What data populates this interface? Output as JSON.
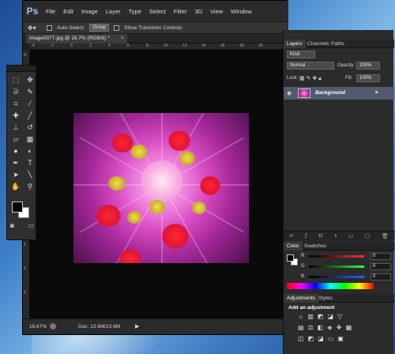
{
  "app": {
    "logo": "Ps"
  },
  "menu": [
    "File",
    "Edit",
    "Image",
    "Layer",
    "Type",
    "Select",
    "Filter",
    "3D",
    "View",
    "Window"
  ],
  "options_bar": {
    "auto_select_label": "Auto-Select:",
    "auto_select_value": "Group",
    "show_transform_label": "Show Transform Controls"
  },
  "document": {
    "tab_title": "Image0077.jpg @ 16.7% (RGB/8) *",
    "close": "×",
    "ruler_top": [
      "4",
      "2",
      "0",
      "2",
      "4",
      "6",
      "8",
      "10",
      "12",
      "14",
      "16",
      "18",
      "20"
    ],
    "ruler_left": [
      "0",
      "2",
      "4",
      "6",
      "8",
      "1",
      "1",
      "1",
      "1",
      "1",
      "2"
    ],
    "zoom": "16.67%",
    "doc_size": "Doc: 13.6M/13.6M"
  },
  "layers_panel": {
    "tabs": [
      "Layers",
      "Channels",
      "Paths"
    ],
    "kind": "Kind",
    "blend_mode": "Normal",
    "opacity_label": "Opacity:",
    "opacity_value": "100%",
    "lock_label": "Lock:",
    "fill_label": "Fill:",
    "fill_value": "100%",
    "layer_name": "Background"
  },
  "color_panel": {
    "tabs": [
      "Color",
      "Swatches"
    ],
    "channels": [
      {
        "label": "R",
        "value": "0",
        "color": "#ff3030"
      },
      {
        "label": "G",
        "value": "0",
        "color": "#30ff30"
      },
      {
        "label": "B",
        "value": "0",
        "color": "#3060ff"
      }
    ]
  },
  "adjustments_panel": {
    "tabs": [
      "Adjustments",
      "Styles"
    ],
    "title": "Add an adjustment"
  },
  "colors": {
    "workspace": "#0a0a0a",
    "panel": "#2b2b2b",
    "selected_layer": "#515a6e"
  }
}
